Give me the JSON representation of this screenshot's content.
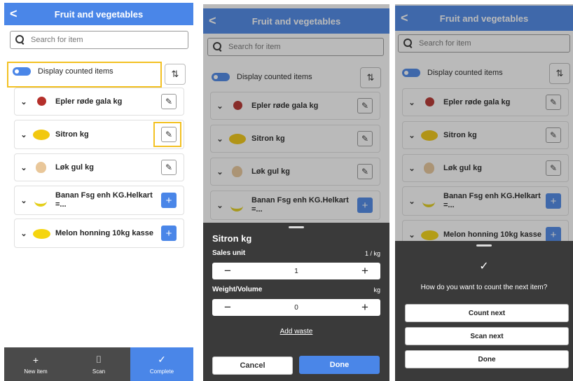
{
  "header": {
    "title": "Fruit and vegetables",
    "back_icon": "chevron-left-icon"
  },
  "search": {
    "placeholder": "Search for item"
  },
  "toggle": {
    "label": "Display counted items",
    "on": true
  },
  "items": [
    {
      "name": "Epler røde gala kg",
      "fruit": "apple",
      "action": "edit"
    },
    {
      "name": "Sitron kg",
      "fruit": "lemon",
      "action": "edit"
    },
    {
      "name": "Løk gul kg",
      "fruit": "onion",
      "action": "edit"
    },
    {
      "name": "Banan Fsg enh KG.Helkart =...",
      "fruit": "banana",
      "action": "add"
    },
    {
      "name": "Melon honning 10kg kasse",
      "fruit": "melon",
      "action": "add"
    }
  ],
  "bottom_nav": [
    {
      "label": "New item",
      "icon": "+"
    },
    {
      "label": "Scan",
      "icon": "⌷"
    },
    {
      "label": "Complete",
      "icon": "✓"
    }
  ],
  "count_sheet": {
    "title": "Sitron kg",
    "sales_unit_label": "Sales unit",
    "sales_unit_value": "1 / kg",
    "sales_unit_qty": "1",
    "weight_label": "Weight/Volume",
    "weight_unit": "kg",
    "weight_qty": "0",
    "add_waste": "Add waste",
    "cancel": "Cancel",
    "done": "Done"
  },
  "next_sheet": {
    "question": "How do you want to count the next item?",
    "count_next": "Count next",
    "scan_next": "Scan next",
    "done": "Done"
  },
  "colors": {
    "accent": "#4a86e8",
    "highlight": "#f3c122",
    "sheet": "#3a3a3a"
  }
}
